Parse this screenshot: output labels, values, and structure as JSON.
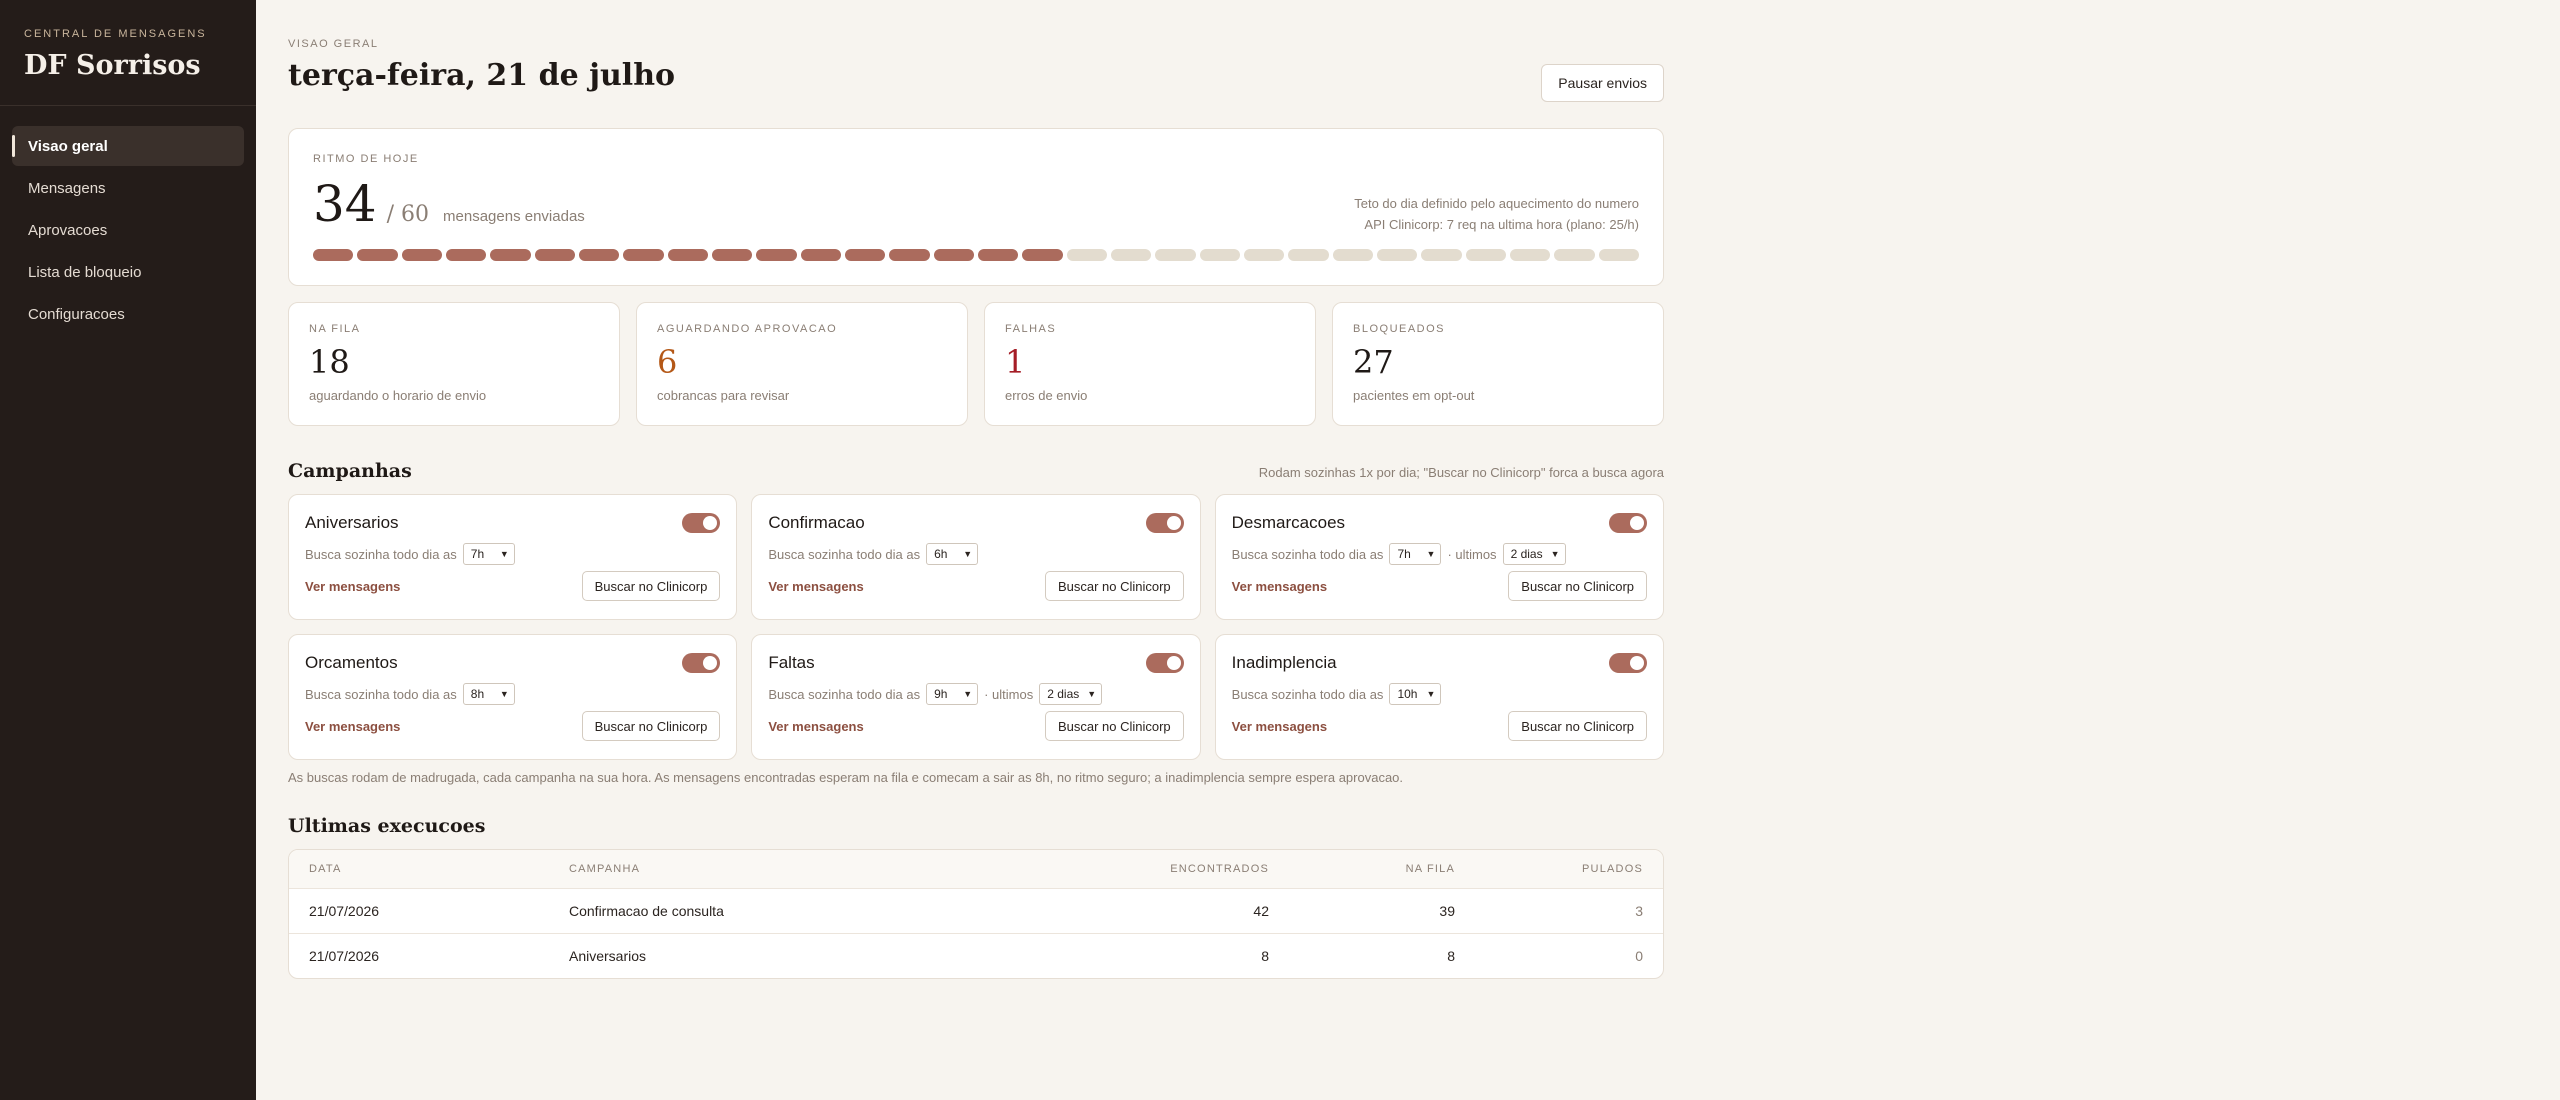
{
  "sidebar": {
    "kicker": "CENTRAL DE MENSAGENS",
    "brand": "DF Sorrisos",
    "items": [
      {
        "label": "Visao geral"
      },
      {
        "label": "Mensagens"
      },
      {
        "label": "Aprovacoes"
      },
      {
        "label": "Lista de bloqueio"
      },
      {
        "label": "Configuracoes"
      }
    ]
  },
  "header": {
    "kicker": "VISAO GERAL",
    "title": "terça-feira, 21 de julho",
    "pause_label": "Pausar envios"
  },
  "pace": {
    "kicker": "RITMO DE HOJE",
    "sent": "34",
    "max": "/ 60",
    "label": "mensagens enviadas",
    "note1": "Teto do dia definido pelo aquecimento do numero",
    "note2": "API Clinicorp: 7 req na ultima hora (plano: 25/h)",
    "segments_total": 30,
    "segments_filled": 17
  },
  "stats": [
    {
      "label": "NA FILA",
      "value": "18",
      "sub": "aguardando o horario de envio"
    },
    {
      "label": "AGUARDANDO APROVACAO",
      "value": "6",
      "sub": "cobrancas para revisar"
    },
    {
      "label": "FALHAS",
      "value": "1",
      "sub": "erros de envio"
    },
    {
      "label": "BLOQUEADOS",
      "value": "27",
      "sub": "pacientes em opt-out"
    }
  ],
  "campaigns": {
    "title": "Campanhas",
    "note": "Rodam sozinhas 1x por dia; \"Buscar no Clinicorp\" forca a busca agora",
    "sched_label": "Busca sozinha todo dia as",
    "last_label": "· ultimos",
    "view_label": "Ver mensagens",
    "fetch_label": "Buscar no Clinicorp",
    "items": [
      {
        "name": "Aniversarios",
        "hour": "7h",
        "days": null,
        "enabled": true
      },
      {
        "name": "Confirmacao",
        "hour": "6h",
        "days": null,
        "enabled": true
      },
      {
        "name": "Desmarcacoes",
        "hour": "7h",
        "days": "2 dias",
        "enabled": true
      },
      {
        "name": "Orcamentos",
        "hour": "8h",
        "days": null,
        "enabled": true
      },
      {
        "name": "Faltas",
        "hour": "9h",
        "days": "2 dias",
        "enabled": true
      },
      {
        "name": "Inadimplencia",
        "hour": "10h",
        "days": null,
        "enabled": true
      }
    ],
    "footnote": "As buscas rodam de madrugada, cada campanha na sua hora. As mensagens encontradas esperam na fila e comecam a sair as 8h, no ritmo seguro; a inadimplencia sempre espera aprovacao."
  },
  "runs": {
    "title": "Ultimas execucoes",
    "headers": [
      "DATA",
      "CAMPANHA",
      "ENCONTRADOS",
      "NA FILA",
      "PULADOS"
    ],
    "rows": [
      [
        "21/07/2026",
        "Confirmacao de consulta",
        "42",
        "39",
        "3"
      ],
      [
        "21/07/2026",
        "Aniversarios",
        "8",
        "8",
        "0"
      ]
    ]
  },
  "colors": {
    "sidebar_bg": "#241c19",
    "accent": "#ab6b5d",
    "warn": "#b45817",
    "error": "#a51d26"
  }
}
